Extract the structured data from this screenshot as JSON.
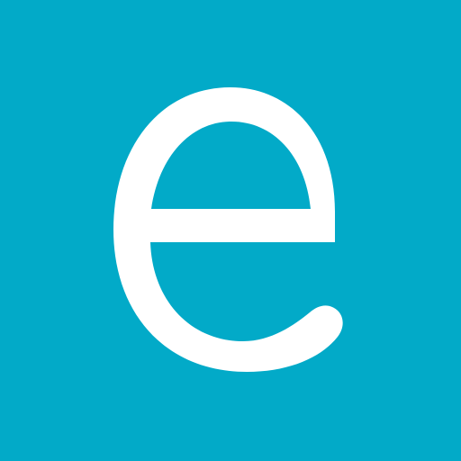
{
  "logo": {
    "letter": "e",
    "background_color": "#02AAC8",
    "glyph_color": "#FFFFFF",
    "icon": "letter-e-logo-icon"
  }
}
